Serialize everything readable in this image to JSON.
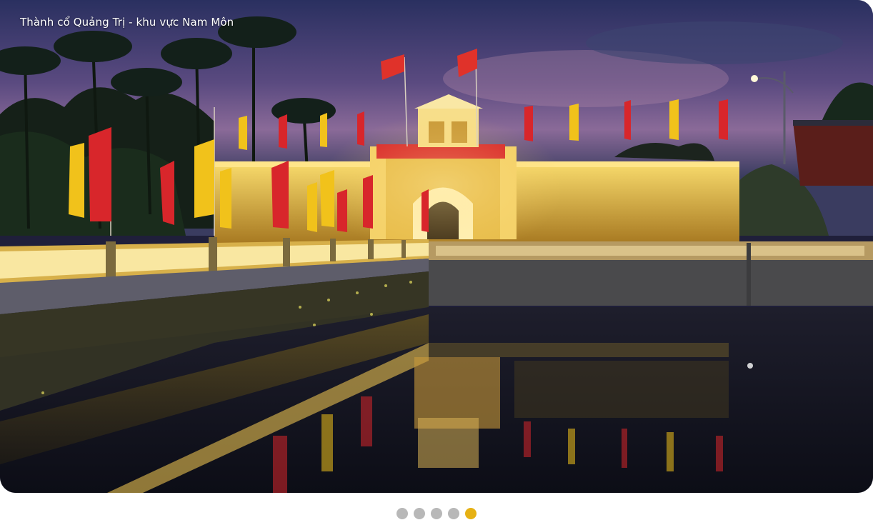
{
  "slider": {
    "caption": "Thành cổ Quảng Trị - khu vực Nam Môn",
    "slide_count": 5,
    "active_slide": 5
  },
  "colors": {
    "active_dot": "#e6b114",
    "inactive_dot": "#b8b8b8",
    "wall_light": "#f4cf55",
    "flag_red": "#d8262b",
    "flag_yellow": "#f1c21b"
  },
  "icons": {
    "slide_image": "night-citadel-gate-photo"
  }
}
